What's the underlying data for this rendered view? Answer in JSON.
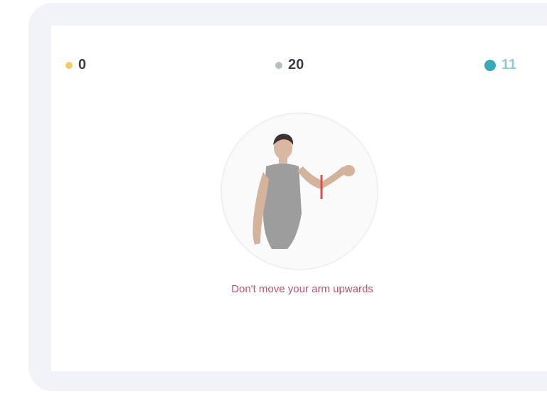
{
  "stats": {
    "left": {
      "value": "0",
      "icon": "star-icon",
      "color": "#f0cc63"
    },
    "center": {
      "value": "20",
      "icon": "gear-icon",
      "color": "#b8bcc3"
    },
    "right": {
      "value": "11",
      "icon": "dot-icon",
      "color": "#38a9b8"
    }
  },
  "exercise": {
    "instruction": "Don't move your arm upwards",
    "illustration": "woman-raising-arm-image"
  },
  "colors": {
    "instruction_text": "#b5546d",
    "frame_bg": "#f1f3f8"
  }
}
